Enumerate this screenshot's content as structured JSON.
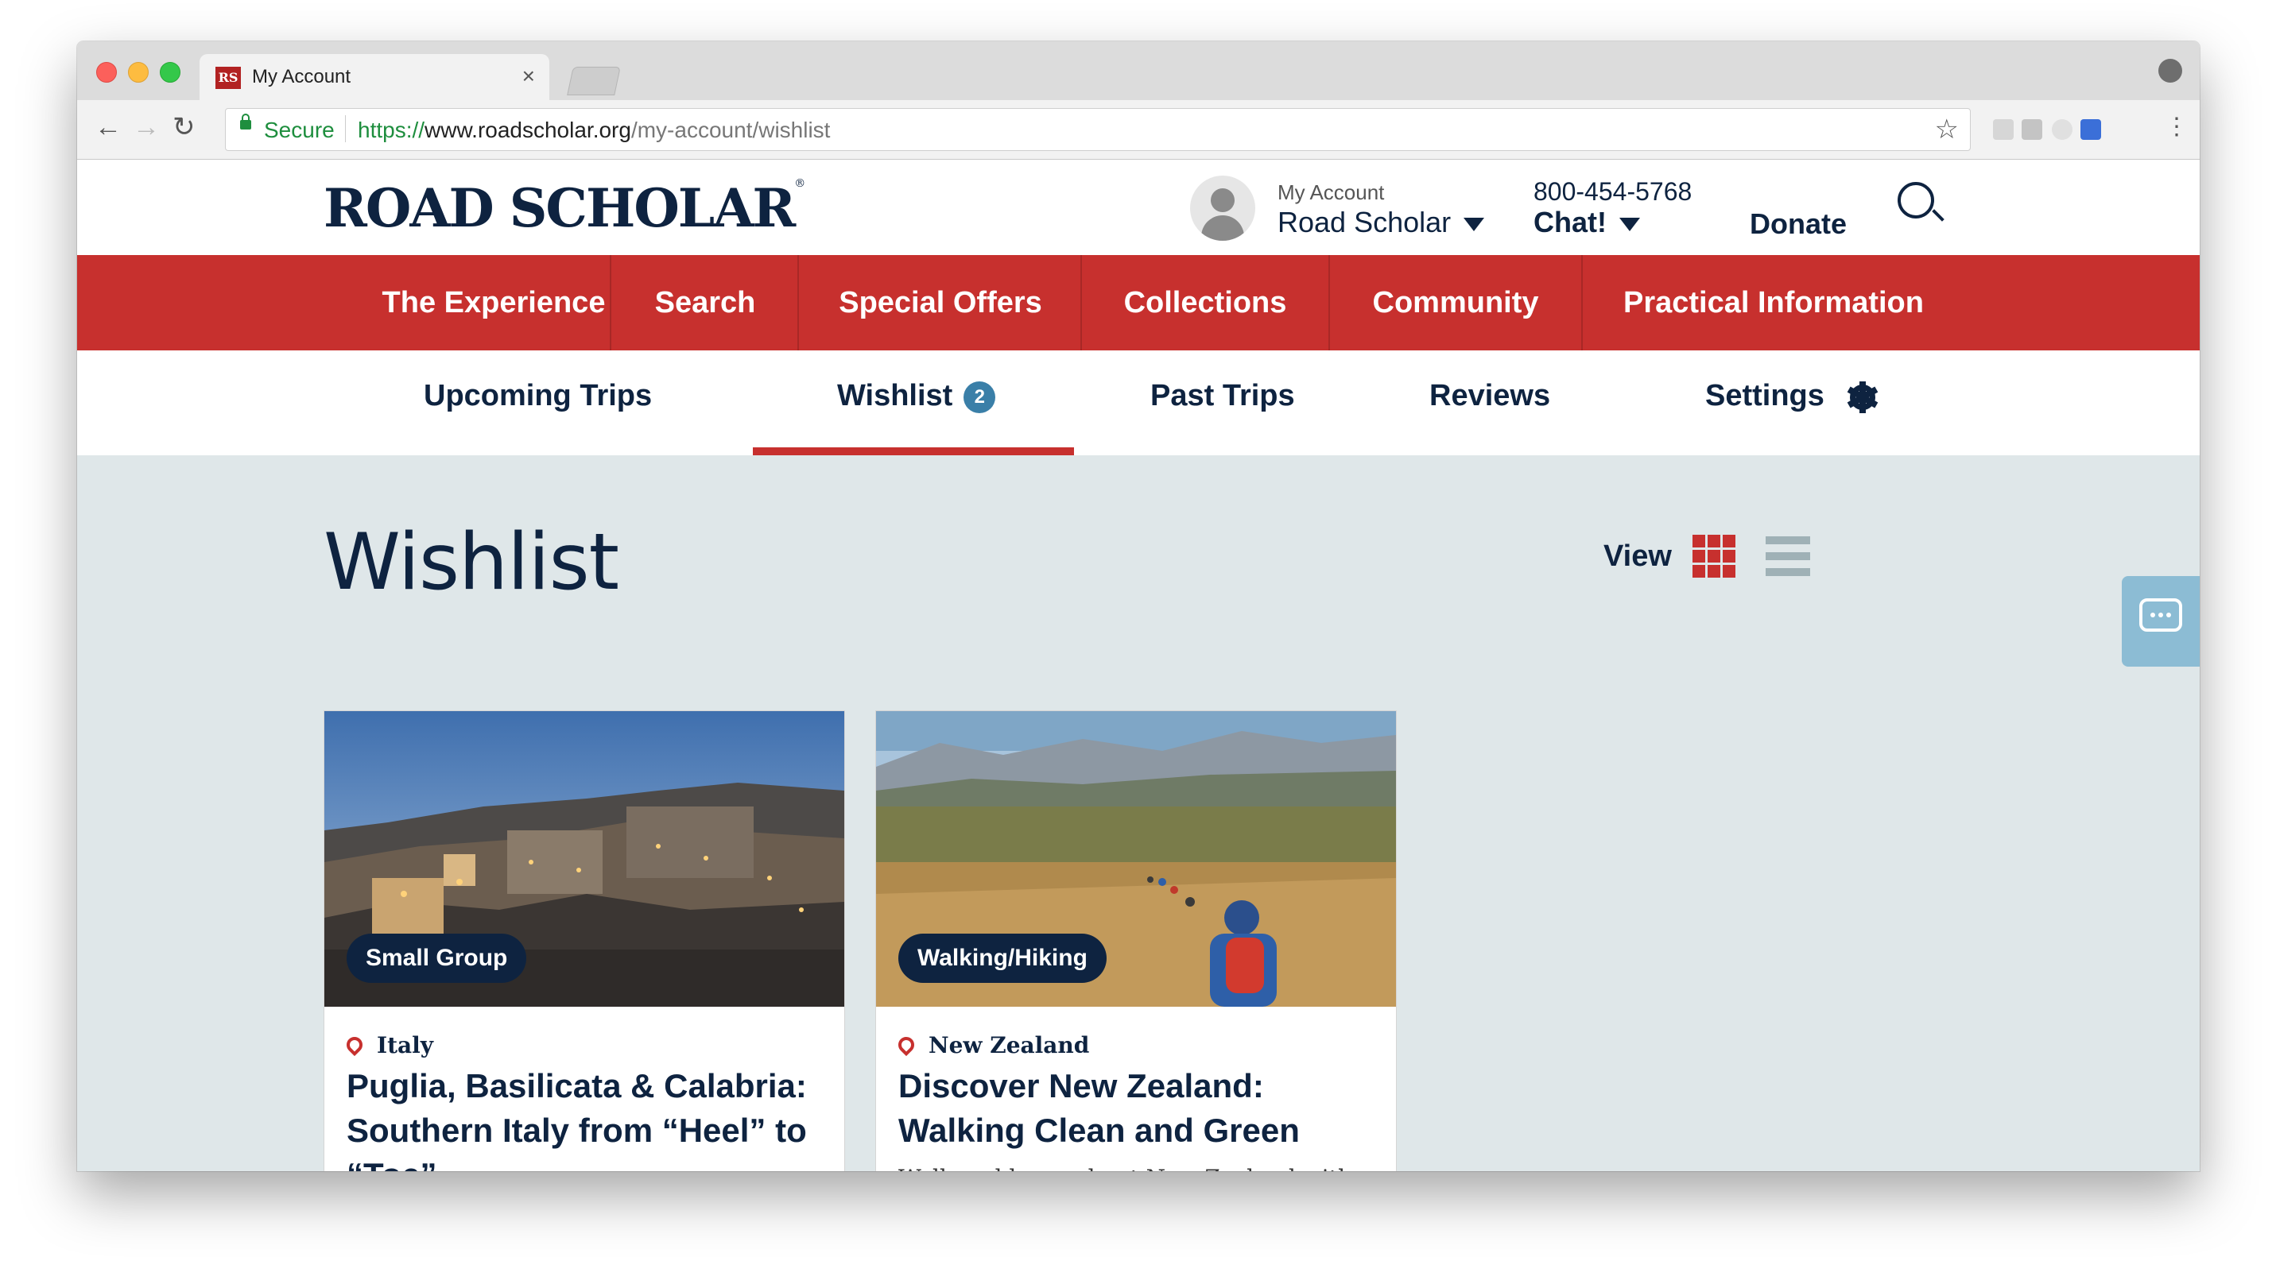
{
  "browser": {
    "tab_title": "My Account",
    "favicon_text": "RS",
    "secure_label": "Secure",
    "url_scheme": "https://",
    "url_host": "www.roadscholar.org",
    "url_path": "/my-account/wishlist"
  },
  "header": {
    "logo": "ROAD SCHOLAR",
    "logo_mark": "®",
    "account_label": "My Account",
    "account_name": "Road Scholar",
    "phone": "800-454-5768",
    "chat_label": "Chat!",
    "donate_label": "Donate"
  },
  "main_nav": [
    {
      "label": "The Experience"
    },
    {
      "label": "Search"
    },
    {
      "label": "Special Offers"
    },
    {
      "label": "Collections"
    },
    {
      "label": "Community"
    },
    {
      "label": "Practical Information"
    }
  ],
  "sub_nav": {
    "upcoming": "Upcoming Trips",
    "wishlist": "Wishlist",
    "wishlist_count": "2",
    "past": "Past Trips",
    "reviews": "Reviews",
    "settings": "Settings",
    "active": "Wishlist"
  },
  "page": {
    "title": "Wishlist",
    "view_label": "View",
    "selected_view": "grid"
  },
  "cards": [
    {
      "tag": "Small Group",
      "location": "Italy",
      "title": "Puglia, Basilicata & Calabria: Southern Italy from “Heel” to “Toe”",
      "description": ""
    },
    {
      "tag": "Walking/Hiking",
      "location": "New Zealand",
      "title": "Discover New Zealand: Walking Clean and Green",
      "description": "Walk and learn about New Zealand with"
    }
  ],
  "colors": {
    "brand_red": "#c7302e",
    "navy": "#0e2340",
    "badge_blue": "#3a7fa8",
    "page_bg": "#dfe7e9"
  }
}
